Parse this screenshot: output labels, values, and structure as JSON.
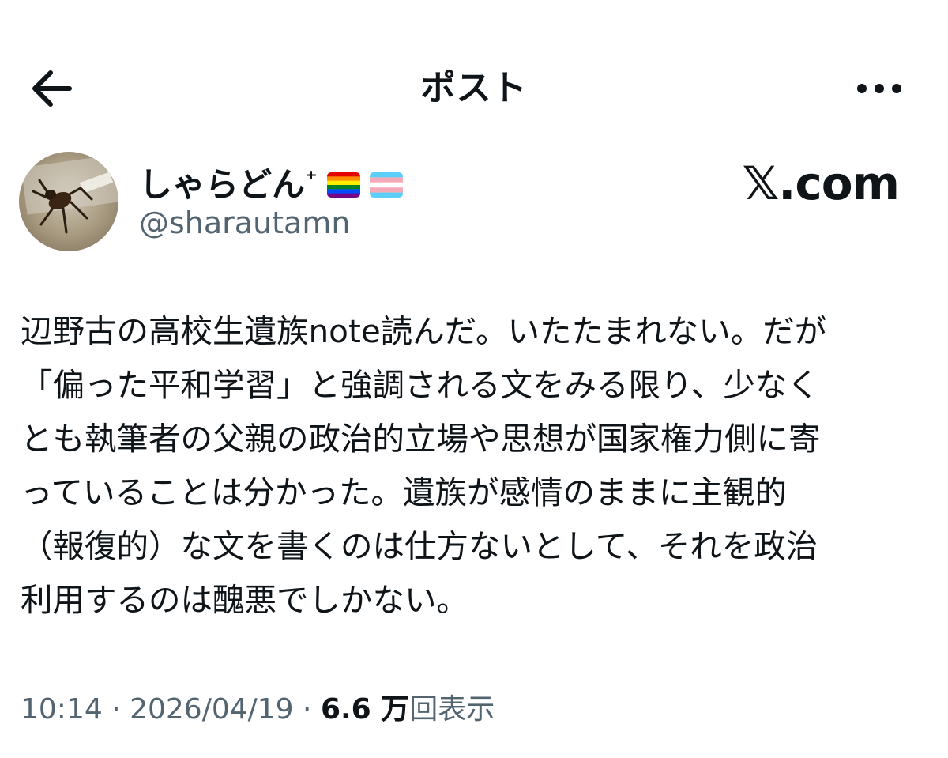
{
  "header": {
    "back_icon": "back-arrow-icon",
    "title": "ポスト",
    "more_icon": "more-dots-icon"
  },
  "author": {
    "display_name": "しゃらどん",
    "name_suffix": "⁺",
    "flags": [
      "rainbow-flag-icon",
      "transgender-flag-icon"
    ],
    "handle": "@sharautamn"
  },
  "site_label": "𝕏.com",
  "post": {
    "lines": [
      "辺野古の高校生遺族note読んだ。いたたまれない。だが",
      "「偏った平和学習」と強調される文をみる限り、少なく",
      "とも執筆者の父親の政治的立場や思想が国家権力側に寄",
      "っていることは分かった。遺族が感情のままに主観的",
      "（報復的）な文を書くのは仕方ないとして、それを政治",
      "利用するのは醜悪でしかない。"
    ]
  },
  "meta": {
    "time": "10:14",
    "separator": " · ",
    "date": "2026/04/19",
    "views_count": "6.6 万",
    "views_label": "回表示"
  },
  "colors": {
    "text": "#0f1419",
    "secondary": "#536471",
    "background": "#ffffff"
  }
}
